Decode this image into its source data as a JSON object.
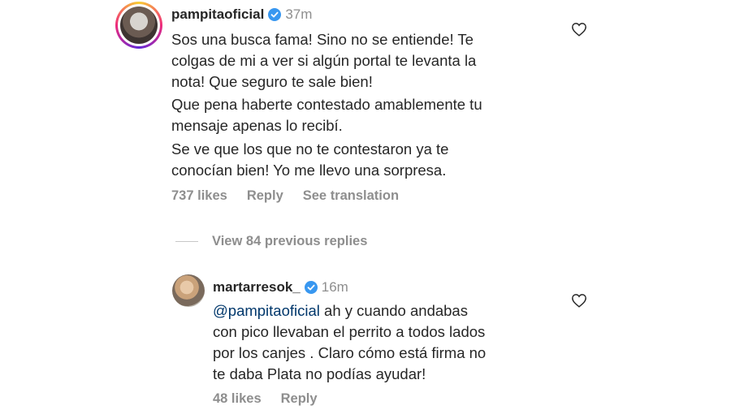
{
  "comment": {
    "username": "pampitaoficial",
    "time": "37m",
    "paragraphs": [
      [
        "Sos una busca fama! Sino no se entiende! Te",
        "colgas de mi a ver si algún portal te levanta la",
        "nota! Que seguro te sale bien!"
      ],
      [
        "Que pena haberte contestado amablemente tu",
        "mensaje apenas lo recibí."
      ],
      [
        "Se ve que los que no te contestaron ya te",
        "conocían bien! Yo me llevo una sorpresa."
      ]
    ],
    "likes": "737 likes",
    "reply_label": "Reply",
    "translation_label": "See translation",
    "icons": {
      "verified": "verified-badge-icon",
      "like": "heart-icon"
    }
  },
  "replies_toggle": {
    "label": "View 84 previous replies"
  },
  "reply": {
    "username": "martarresok_",
    "time": "16m",
    "mention": "@pampitaoficial",
    "lines": [
      " ah y cuando andabas",
      "con pico llevaban el perrito a todos lados",
      "por los canjes . Claro cómo está firma no",
      "te daba Plata no podías ayudar!"
    ],
    "likes": "48 likes",
    "reply_label": "Reply"
  },
  "colors": {
    "verified_blue": "#3897f0",
    "text": "#262626",
    "muted": "#8e8e8e",
    "mention": "#00376b"
  }
}
